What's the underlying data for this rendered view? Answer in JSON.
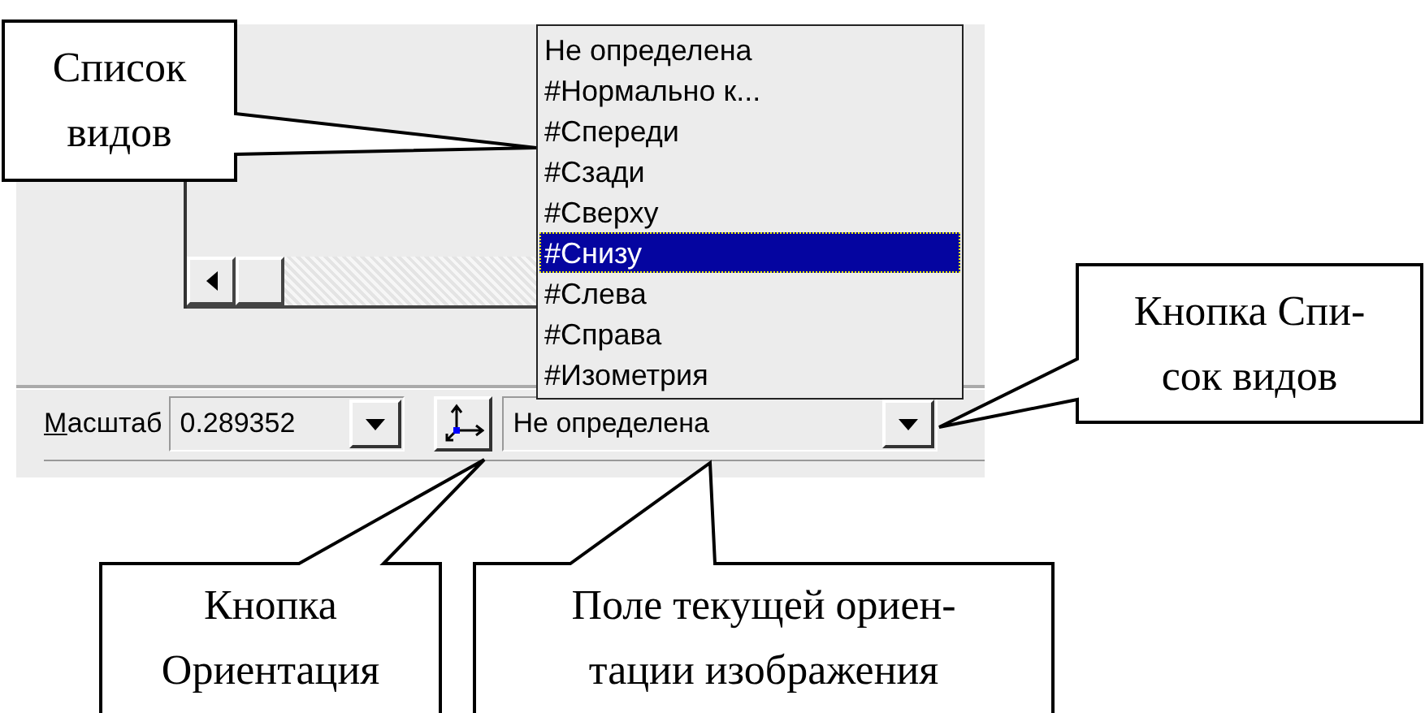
{
  "views_list": {
    "items": [
      {
        "label": "Не определена",
        "selected": false
      },
      {
        "label": "#Нормально к...",
        "selected": false
      },
      {
        "label": "#Спереди",
        "selected": false
      },
      {
        "label": "#Сзади",
        "selected": false
      },
      {
        "label": "#Сверху",
        "selected": false
      },
      {
        "label": "#Снизу",
        "selected": true
      },
      {
        "label": "#Слева",
        "selected": false
      },
      {
        "label": "#Справа",
        "selected": false
      },
      {
        "label": "#Изометрия",
        "selected": false
      }
    ]
  },
  "toolbar": {
    "scale_label": "Масштаб",
    "scale_value": "0.289352",
    "orientation_value": "Не определена"
  },
  "callouts": [
    {
      "lines": [
        "Список",
        "видов"
      ]
    },
    {
      "lines": [
        "Кнопка Спи-",
        "сок видов"
      ]
    },
    {
      "lines": [
        "Кнопка",
        "Ориентация"
      ]
    },
    {
      "lines": [
        "Поле текущей ориен-",
        "тации изображения"
      ]
    }
  ]
}
